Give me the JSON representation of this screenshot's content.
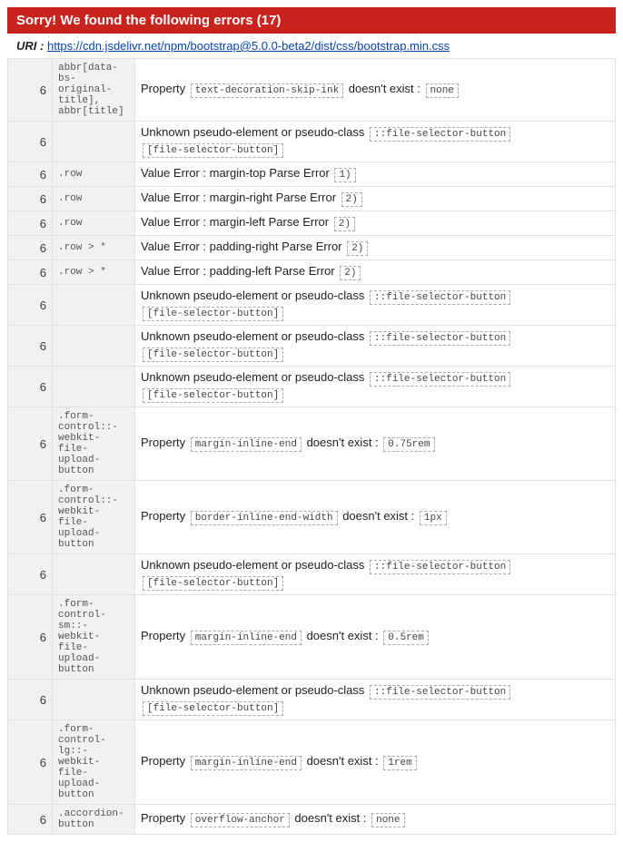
{
  "header": {
    "title": "Sorry! We found the following errors (17)"
  },
  "uri": {
    "label": "URI :",
    "href": "https://cdn.jsdelivr.net/npm/bootstrap@5.0.0-beta2/dist/css/bootstrap.min.css"
  },
  "rows": [
    {
      "line": "6",
      "selector": "abbr[data-bs-original-title], abbr[title]",
      "msg": [
        {
          "t": "text",
          "v": "Property "
        },
        {
          "t": "chip",
          "v": "text-decoration-skip-ink"
        },
        {
          "t": "text",
          "v": " doesn't exist : "
        },
        {
          "t": "chip",
          "v": "none"
        }
      ]
    },
    {
      "line": "6",
      "selector": "",
      "msg": [
        {
          "t": "text",
          "v": "Unknown pseudo-element or pseudo-class "
        },
        {
          "t": "chip",
          "v": "::file-selector-button"
        },
        {
          "t": "chip",
          "v": "[file-selector-button]"
        }
      ]
    },
    {
      "line": "6",
      "selector": ".row",
      "msg": [
        {
          "t": "text",
          "v": "Value Error : margin-top Parse Error "
        },
        {
          "t": "chip",
          "v": "1)"
        }
      ]
    },
    {
      "line": "6",
      "selector": ".row",
      "msg": [
        {
          "t": "text",
          "v": "Value Error : margin-right Parse Error "
        },
        {
          "t": "chip",
          "v": "2)"
        }
      ]
    },
    {
      "line": "6",
      "selector": ".row",
      "msg": [
        {
          "t": "text",
          "v": "Value Error : margin-left Parse Error "
        },
        {
          "t": "chip",
          "v": "2)"
        }
      ]
    },
    {
      "line": "6",
      "selector": ".row > *",
      "msg": [
        {
          "t": "text",
          "v": "Value Error : padding-right Parse Error "
        },
        {
          "t": "chip",
          "v": "2)"
        }
      ]
    },
    {
      "line": "6",
      "selector": ".row > *",
      "msg": [
        {
          "t": "text",
          "v": "Value Error : padding-left Parse Error "
        },
        {
          "t": "chip",
          "v": "2)"
        }
      ]
    },
    {
      "line": "6",
      "selector": "",
      "msg": [
        {
          "t": "text",
          "v": "Unknown pseudo-element or pseudo-class "
        },
        {
          "t": "chip",
          "v": "::file-selector-button"
        },
        {
          "t": "chip",
          "v": "[file-selector-button]"
        }
      ]
    },
    {
      "line": "6",
      "selector": "",
      "msg": [
        {
          "t": "text",
          "v": "Unknown pseudo-element or pseudo-class "
        },
        {
          "t": "chip",
          "v": "::file-selector-button"
        },
        {
          "t": "chip",
          "v": "[file-selector-button]"
        }
      ]
    },
    {
      "line": "6",
      "selector": "",
      "msg": [
        {
          "t": "text",
          "v": "Unknown pseudo-element or pseudo-class "
        },
        {
          "t": "chip",
          "v": "::file-selector-button"
        },
        {
          "t": "chip",
          "v": "[file-selector-button]"
        }
      ]
    },
    {
      "line": "6",
      "selector": ".form-control::-webkit-file-upload-button",
      "msg": [
        {
          "t": "text",
          "v": "Property "
        },
        {
          "t": "chip",
          "v": "margin-inline-end"
        },
        {
          "t": "text",
          "v": " doesn't exist : "
        },
        {
          "t": "chip",
          "v": "0.75rem"
        }
      ]
    },
    {
      "line": "6",
      "selector": ".form-control::-webkit-file-upload-button",
      "msg": [
        {
          "t": "text",
          "v": "Property "
        },
        {
          "t": "chip",
          "v": "border-inline-end-width"
        },
        {
          "t": "text",
          "v": " doesn't exist : "
        },
        {
          "t": "chip",
          "v": "1px"
        }
      ]
    },
    {
      "line": "6",
      "selector": "",
      "msg": [
        {
          "t": "text",
          "v": "Unknown pseudo-element or pseudo-class "
        },
        {
          "t": "chip",
          "v": "::file-selector-button"
        },
        {
          "t": "chip",
          "v": "[file-selector-button]"
        }
      ]
    },
    {
      "line": "6",
      "selector": ".form-control-sm::-webkit-file-upload-button",
      "msg": [
        {
          "t": "text",
          "v": "Property "
        },
        {
          "t": "chip",
          "v": "margin-inline-end"
        },
        {
          "t": "text",
          "v": " doesn't exist : "
        },
        {
          "t": "chip",
          "v": "0.5rem"
        }
      ]
    },
    {
      "line": "6",
      "selector": "",
      "msg": [
        {
          "t": "text",
          "v": "Unknown pseudo-element or pseudo-class "
        },
        {
          "t": "chip",
          "v": "::file-selector-button"
        },
        {
          "t": "chip",
          "v": "[file-selector-button]"
        }
      ]
    },
    {
      "line": "6",
      "selector": ".form-control-lg::-webkit-file-upload-button",
      "msg": [
        {
          "t": "text",
          "v": "Property "
        },
        {
          "t": "chip",
          "v": "margin-inline-end"
        },
        {
          "t": "text",
          "v": " doesn't exist : "
        },
        {
          "t": "chip",
          "v": "1rem"
        }
      ]
    },
    {
      "line": "6",
      "selector": ".accordion-button",
      "msg": [
        {
          "t": "text",
          "v": "Property "
        },
        {
          "t": "chip",
          "v": "overflow-anchor"
        },
        {
          "t": "text",
          "v": " doesn't exist : "
        },
        {
          "t": "chip",
          "v": "none"
        }
      ]
    }
  ]
}
